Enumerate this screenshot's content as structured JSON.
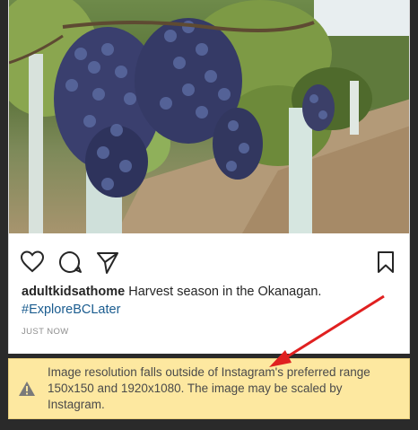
{
  "post": {
    "image_description": "grape-cluster-photo",
    "username": "adultkidsathome",
    "caption": "Harvest season in the Okanagan.",
    "hashtag": "#ExploreBCLater",
    "timestamp": "JUST NOW"
  },
  "actions": {
    "like_icon": "heart-icon",
    "comment_icon": "comment-icon",
    "share_icon": "send-icon",
    "save_icon": "bookmark-icon"
  },
  "warning": {
    "icon": "warning-triangle-icon",
    "message": "Image resolution falls outside of Instagram's preferred range 150x150 and 1920x1080. The image may be scaled by Instagram."
  },
  "colors": {
    "warning_background": "#fde8a0",
    "annotation_arrow": "#e02020",
    "hashtag_link": "#1a5c8f"
  }
}
